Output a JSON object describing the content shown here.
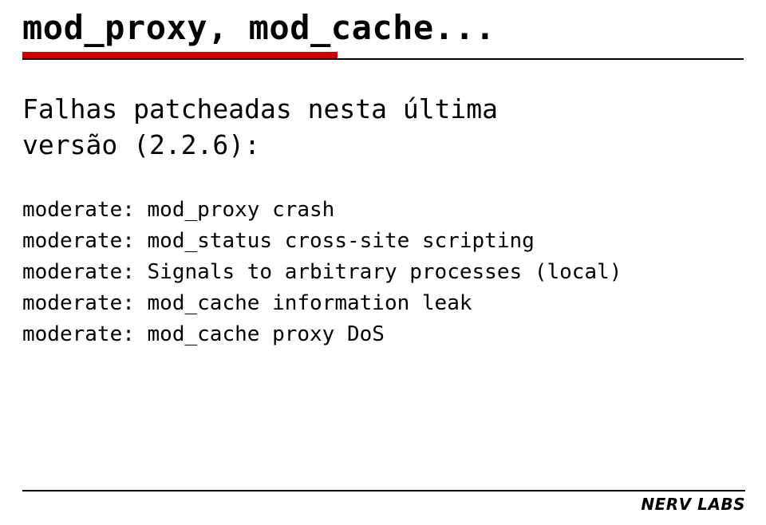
{
  "title": "mod_proxy, mod_cache...",
  "intro_line1": "Falhas patcheadas nesta última",
  "intro_line2": "versão (2.2.6):",
  "items": [
    "moderate: mod_proxy crash",
    "moderate: mod_status cross-site scripting",
    "moderate: Signals to arbitrary processes (local)",
    "moderate: mod_cache information leak",
    "moderate: mod_cache proxy DoS"
  ],
  "footer": "NERV LABS"
}
